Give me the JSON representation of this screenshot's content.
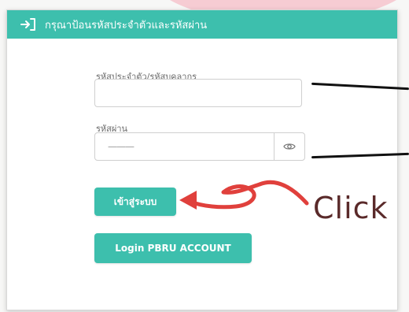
{
  "header": {
    "title": "กรุณาป้อนรหัสประจำตัวและรหัสผ่าน",
    "icon": "login-arrow-icon"
  },
  "form": {
    "id_label": "รหัสประจำตัว/รหัสบุคลากร",
    "id_value": "",
    "password_label": "รหัสผ่าน",
    "password_value": "———",
    "eye_icon": "eye-icon"
  },
  "buttons": {
    "login_label": "เข้าสู่ระบบ",
    "pbru_label": "Login PBRU ACCOUNT"
  },
  "annotation": {
    "click_text": "Click",
    "arrow_color": "#e0403c"
  },
  "colors": {
    "accent": "#3dbfad"
  }
}
